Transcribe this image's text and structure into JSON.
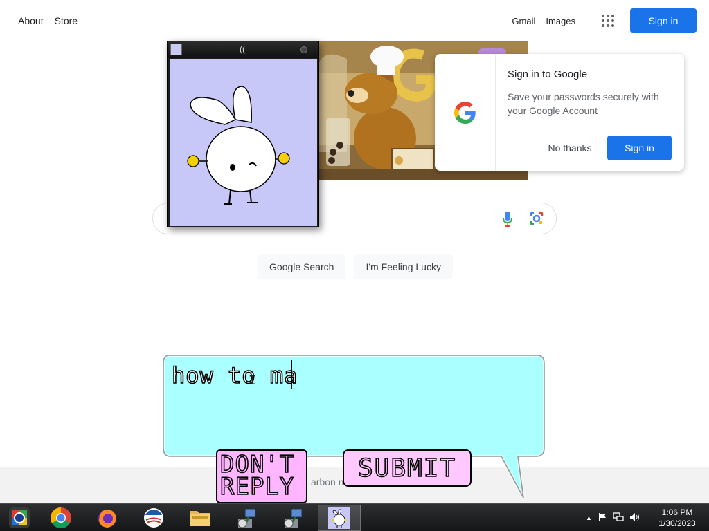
{
  "google": {
    "nav_left": [
      "About",
      "Store"
    ],
    "nav_right": {
      "gmail": "Gmail",
      "images": "Images",
      "signin": "Sign in"
    },
    "search_buttons": {
      "search": "Google Search",
      "lucky": "I'm Feeling Lucky"
    },
    "footer_fragment": "arbon n"
  },
  "signin_card": {
    "title": "Sign in to Google",
    "body": "Save your passwords securely with your Google Account",
    "no_thanks": "No thanks",
    "signin": "Sign in"
  },
  "pet_window": {
    "title_char": "(("
  },
  "bubble": {
    "text": "how to ma",
    "dont_reply": "DON'T REPLY",
    "submit": "SUBMIT"
  },
  "taskbar": {
    "time": "1:06 PM",
    "date": "1/30/2023",
    "apps": [
      "start-orb",
      "chrome",
      "firefox",
      "obama-logo-app",
      "file-explorer",
      "installer",
      "installer",
      "bunny-app"
    ]
  },
  "colors": {
    "google_blue": "#1a73e8",
    "bubble_fill": "#aaffff",
    "button_pink": "#ffb6ff",
    "pet_bg": "#c8c8f8"
  }
}
